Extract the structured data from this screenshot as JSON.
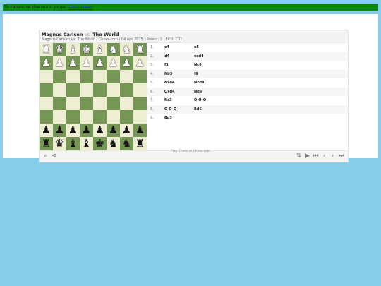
{
  "topbar": {
    "text": "To return to the main page: ",
    "link_label": "Click Here!"
  },
  "game": {
    "white": "Magnus Carlsen",
    "vs": "vs.",
    "black": "The World",
    "subtitle": "Magnus Carlsen Vs. The World / Chess.com / 04 Apr 2025 | Round: 2 | ECO: C21"
  },
  "board": {
    "rows": [
      [
        "wR",
        "wQ",
        "wB",
        "wK",
        "wB",
        "wN",
        "wN",
        "wR"
      ],
      [
        "wP",
        "wP",
        "wP",
        "wP",
        "wP",
        "wP",
        "wP",
        "wP"
      ],
      [
        "",
        "",
        "",
        "",
        "",
        "",
        "",
        ""
      ],
      [
        "",
        "",
        "",
        "",
        "",
        "",
        "",
        ""
      ],
      [
        "",
        "",
        "",
        "",
        "",
        "",
        "",
        ""
      ],
      [
        "",
        "",
        "",
        "",
        "",
        "",
        "",
        ""
      ],
      [
        "bP",
        "bP",
        "bP",
        "bP",
        "bP",
        "bP",
        "bP",
        "bP"
      ],
      [
        "bR",
        "bQ",
        "bB",
        "bB",
        "bK",
        "bN",
        "bN",
        "bR"
      ]
    ],
    "light_color": "#eeeed2",
    "dark_color": "#769656"
  },
  "moves": [
    {
      "num": "1.",
      "white": "e4",
      "black": "e5"
    },
    {
      "num": "2.",
      "white": "d4",
      "black": "exd4"
    },
    {
      "num": "3.",
      "white": "f3",
      "black": "Nc6"
    },
    {
      "num": "4.",
      "white": "Nb3",
      "black": "f6"
    },
    {
      "num": "5.",
      "white": "Nxd4",
      "black": "Nxd4"
    },
    {
      "num": "6.",
      "white": "Qxd4",
      "black": "Nb6"
    },
    {
      "num": "7.",
      "white": "Nc3",
      "black": "O-O-O"
    },
    {
      "num": "8.",
      "white": "O-O-O",
      "black": "Bd6"
    },
    {
      "num": "9.",
      "white": "Bg3",
      "black": ""
    }
  ],
  "toolbar": {
    "left": [
      {
        "name": "zoom-icon",
        "glyph": "⌕"
      },
      {
        "name": "share-icon",
        "glyph": "⋖"
      }
    ],
    "right": [
      {
        "name": "flip-board-icon",
        "glyph": "⇅"
      },
      {
        "name": "play-icon",
        "glyph": "▶"
      },
      {
        "name": "first-move-icon",
        "glyph": "⏮"
      },
      {
        "name": "prev-move-icon",
        "glyph": "‹"
      },
      {
        "name": "next-move-icon",
        "glyph": "›"
      },
      {
        "name": "last-move-icon",
        "glyph": "⏭"
      }
    ]
  },
  "footer": {
    "text": "Play Chess at Chess.com"
  }
}
